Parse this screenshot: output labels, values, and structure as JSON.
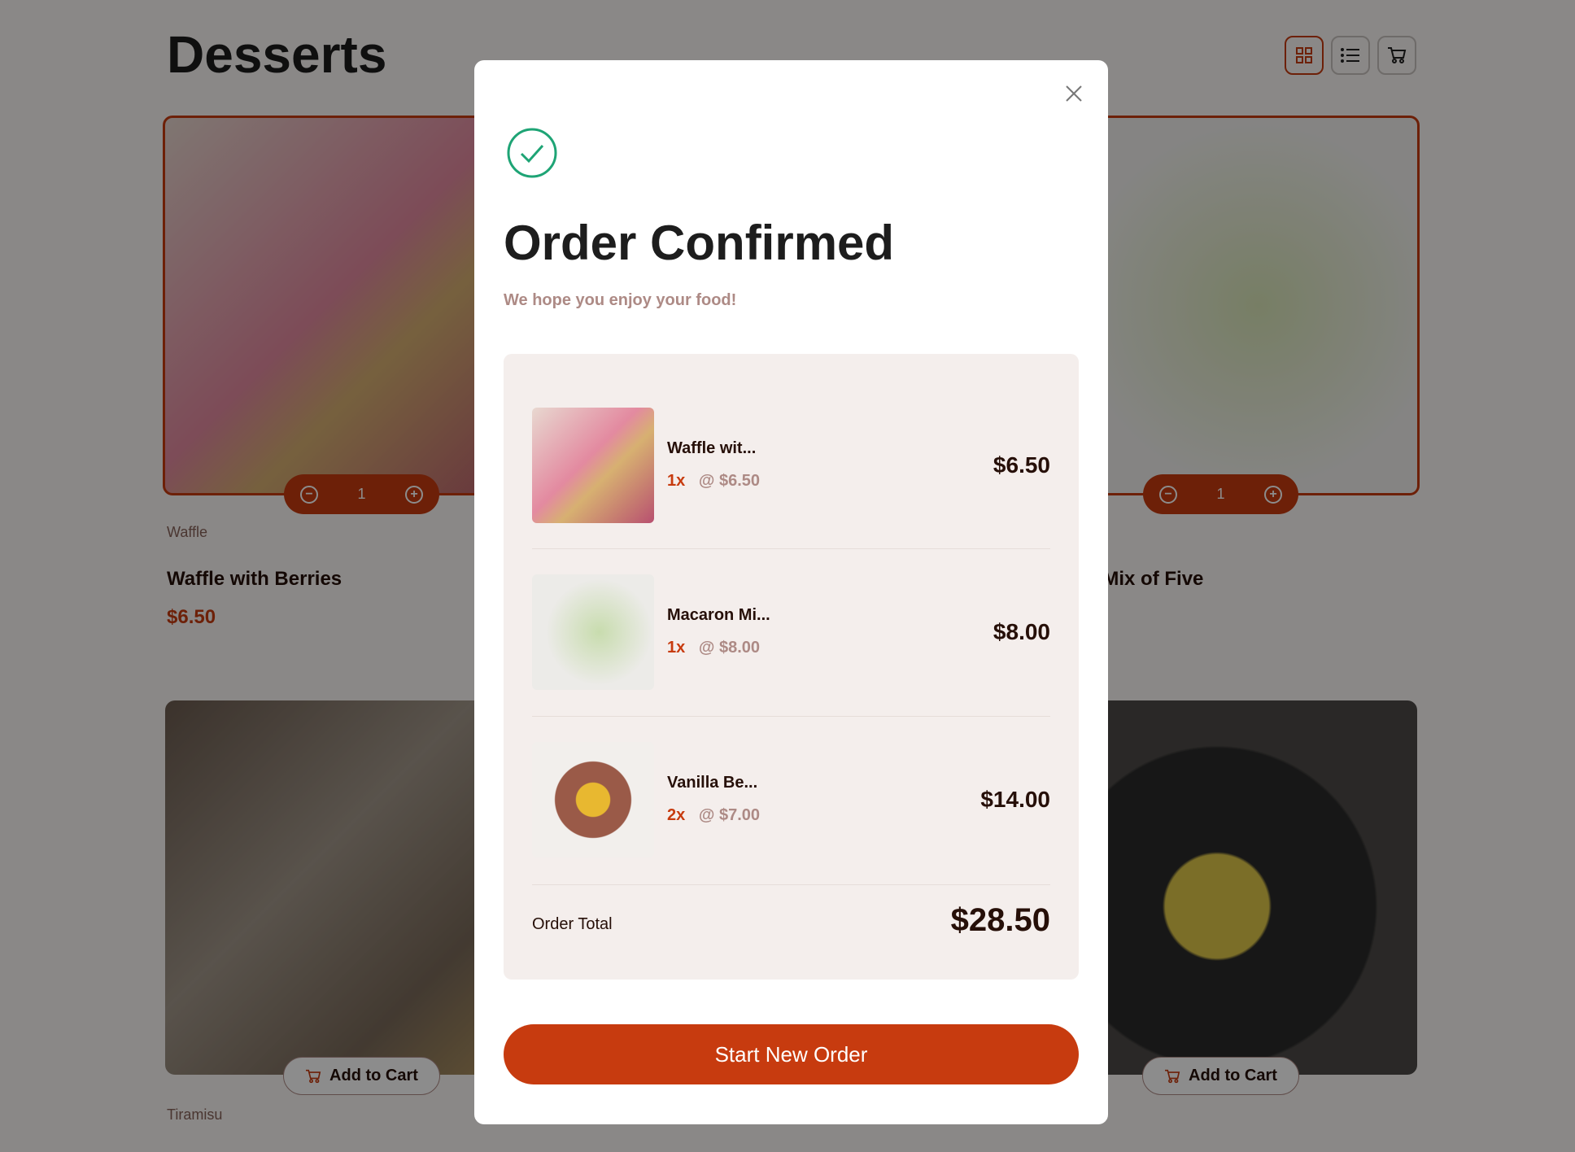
{
  "page": {
    "title": "Desserts"
  },
  "view_icons": [
    "grid-icon",
    "list-icon",
    "cart-icon"
  ],
  "cards": [
    {
      "category": "Waffle",
      "name": "Waffle with Berries",
      "price": "$6.50",
      "quantity": "1"
    },
    {
      "name": "Macaron Mix of Five",
      "quantity": "1"
    },
    {
      "category": "Tiramisu",
      "add_label": "Add to Cart"
    },
    {
      "add_label": "Add to Cart"
    }
  ],
  "modal": {
    "title": "Order Confirmed",
    "subtitle": "We hope you enjoy your food!",
    "items": [
      {
        "name": "Waffle wit...",
        "qty": "1x",
        "unit": "@ $6.50",
        "total": "$6.50"
      },
      {
        "name": "Macaron Mi...",
        "qty": "1x",
        "unit": "@ $8.00",
        "total": "$8.00"
      },
      {
        "name": "Vanilla Be...",
        "qty": "2x",
        "unit": "@ $7.00",
        "total": "$14.00"
      }
    ],
    "total_label": "Order Total",
    "total": "$28.50",
    "button": "Start New Order"
  },
  "colors": {
    "accent": "#c73b0f",
    "success": "#1ea475",
    "cream": "#f4eeec"
  }
}
